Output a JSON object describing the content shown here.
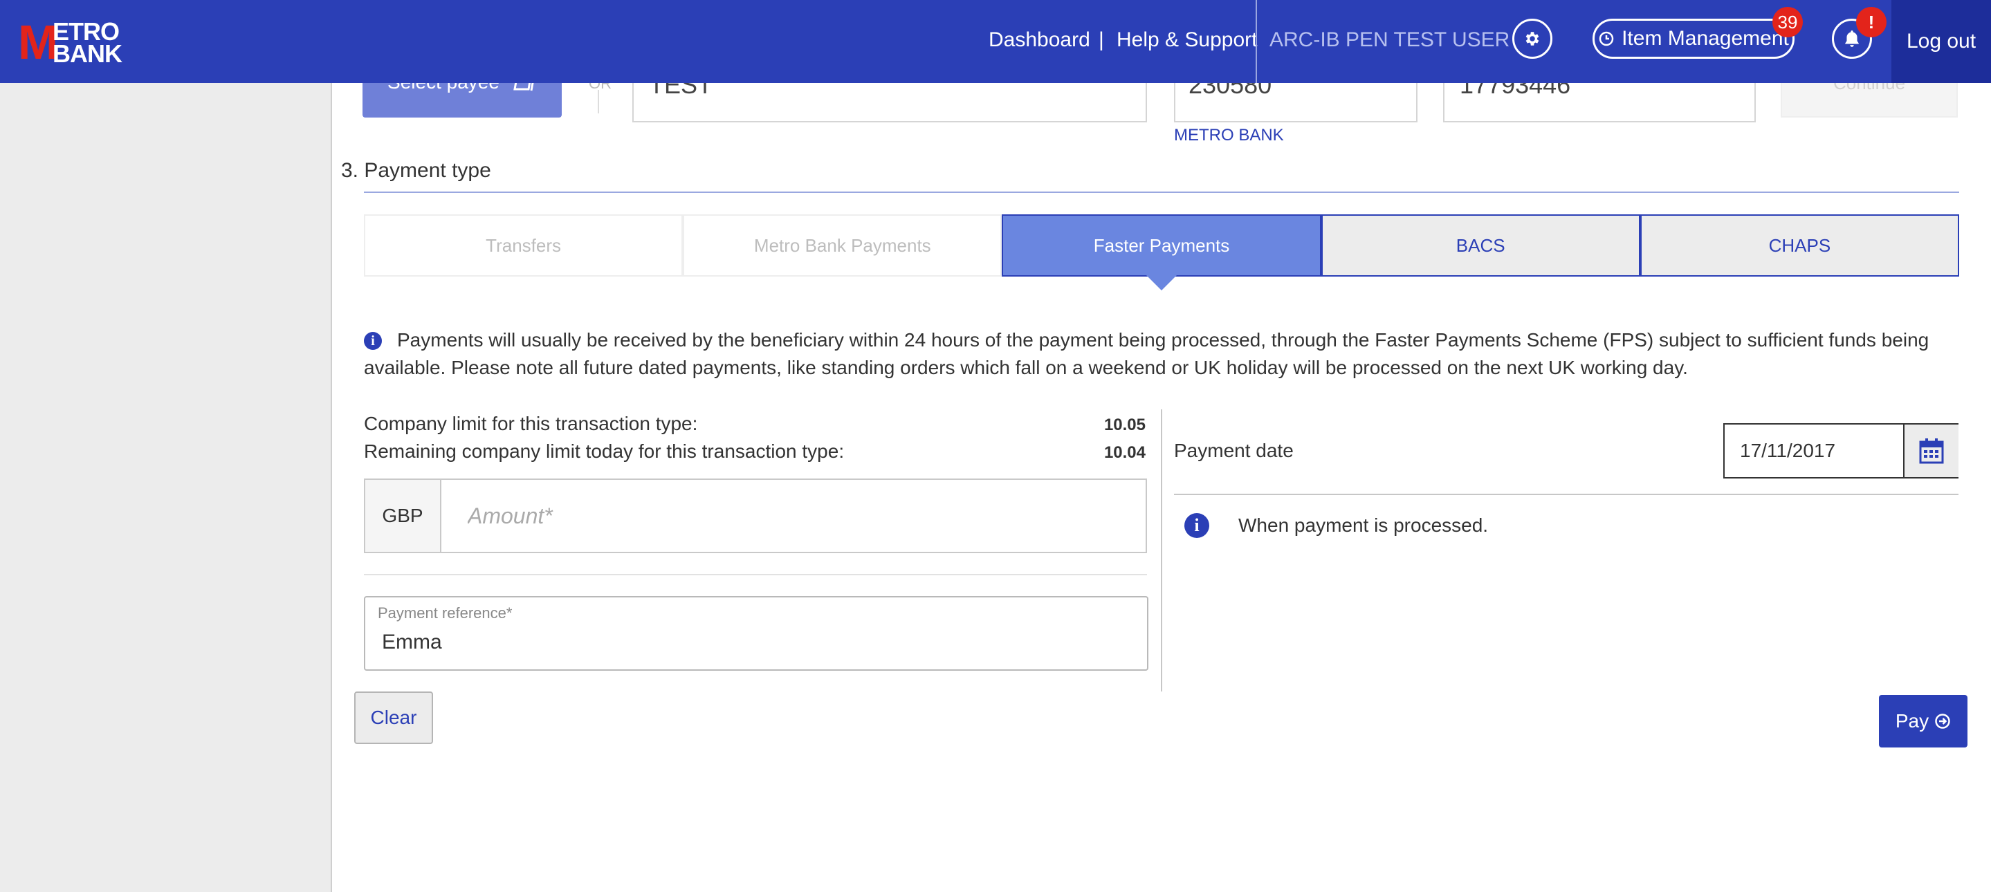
{
  "header": {
    "logo_top": "ETRO",
    "logo_bottom": "BANK",
    "logo_m": "M",
    "nav": {
      "dashboard": "Dashboard",
      "separator": "|",
      "help": "Help & Support"
    },
    "user": "ARC-IB PEN TEST USER",
    "item_management": "Item Management",
    "item_badge": "39",
    "notification_badge": "!",
    "logout": "Log out"
  },
  "payee_row": {
    "select_payee": "Select payee",
    "or": "OR",
    "payee_name": "TEST",
    "sort_code": "230580",
    "account_number": "17793446",
    "bank_name": "METRO BANK",
    "continue": "Continue"
  },
  "payment_type": {
    "title": "3. Payment type",
    "tabs": [
      {
        "label": "Transfers",
        "state": "disabled"
      },
      {
        "label": "Metro Bank Payments",
        "state": "disabled"
      },
      {
        "label": "Faster Payments",
        "state": "active"
      },
      {
        "label": "BACS",
        "state": "normal"
      },
      {
        "label": "CHAPS",
        "state": "normal"
      }
    ],
    "info": "Payments will usually be received by the beneficiary within 24 hours of the payment being processed, through the Faster Payments Scheme (FPS) subject to sufficient funds being available. Please note all future dated payments, like standing orders which fall on a weekend or UK holiday will be processed on the next UK working day."
  },
  "limits": {
    "company_label": "Company limit for this transaction type:",
    "company_value": "10.05",
    "remaining_label": "Remaining company limit today for this transaction type:",
    "remaining_value": "10.04"
  },
  "amount": {
    "currency": "GBP",
    "placeholder": "Amount*",
    "value": ""
  },
  "reference": {
    "label": "Payment reference*",
    "value": "Emma"
  },
  "payment_date": {
    "label": "Payment date",
    "value": "17/11/2017",
    "info": "When payment is processed."
  },
  "buttons": {
    "clear": "Clear",
    "pay": "Pay"
  },
  "colors": {
    "brand_blue": "#2b3fb6",
    "active_tab": "#6a86e0",
    "brand_red": "#e3241b"
  }
}
